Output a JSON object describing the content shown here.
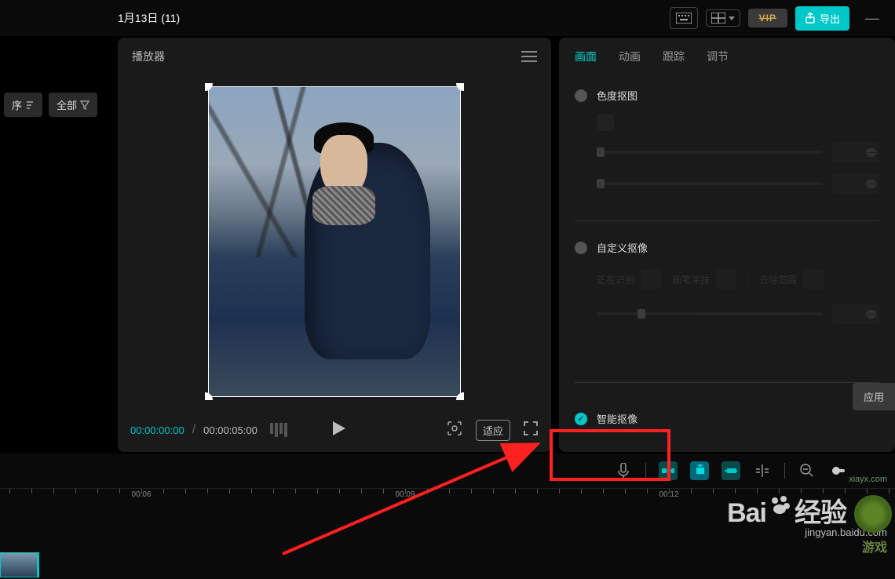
{
  "topbar": {
    "title": "1月13日 (11)",
    "vip": "VIP",
    "export": "导出"
  },
  "sort": {
    "order": "序",
    "all": "全部"
  },
  "player": {
    "title": "播放器",
    "cur": "00:00:00:00",
    "total": "00:00:05:00",
    "fit": "适应"
  },
  "tabs": {
    "t1": "画面",
    "t2": "动画",
    "t3": "跟踪",
    "t4": "调节"
  },
  "sections": {
    "chroma": "色度抠图",
    "custom": "自定义抠像",
    "smart": "智能抠像",
    "apply": "应用"
  },
  "dim_chips": {
    "c1": "正在识别",
    "c2": "画笔涂抹",
    "c3": "去除范围"
  },
  "timeline": {
    "t1": "00:06",
    "t2": "00:09",
    "t3": "00:12"
  },
  "watermark": {
    "main": "Baidu 经验",
    "url": "jingyan.baidu.com",
    "site": "xiayx.com",
    "corner": "游戏"
  }
}
